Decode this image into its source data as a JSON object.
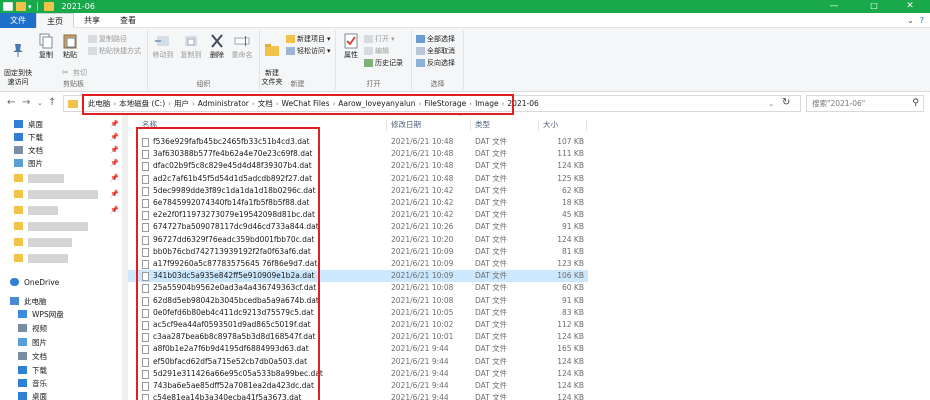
{
  "window": {
    "title": "2021-06",
    "minimize_glyph": "—",
    "maximize_glyph": "□",
    "close_glyph": "✕"
  },
  "ribbon_tabs": [
    "文件",
    "主页",
    "共享",
    "查看"
  ],
  "ribbon": {
    "clipboard": {
      "label": "剪贴板",
      "pin": "固定到快\n速访问",
      "copy": "复制",
      "paste": "粘贴",
      "copy_path": "复制路径",
      "paste_shortcut": "粘贴快捷方式",
      "cut": "剪切"
    },
    "organize": {
      "label": "组织",
      "move_to": "移动到",
      "copy_to": "复制到",
      "delete": "删除",
      "rename": "重命名"
    },
    "new": {
      "label": "新建",
      "new_folder": "新建\n文件夹",
      "new_item": "新建项目",
      "easy_access": "轻松访问"
    },
    "open": {
      "label": "打开",
      "properties": "属性",
      "open": "打开",
      "edit": "编辑",
      "history": "历史记录"
    },
    "select": {
      "label": "选择",
      "select_all": "全部选择",
      "select_none": "全部取消",
      "invert": "反向选择"
    }
  },
  "address": {
    "crumbs": [
      "此电脑",
      "本地磁盘 (C:)",
      "用户",
      "Administrator",
      "文档",
      "WeChat Files",
      "Aarow_loveyanyalun",
      "FileStorage",
      "Image",
      "2021-06"
    ],
    "separator": "›",
    "search_placeholder": "搜索\"2021-06\""
  },
  "nav_pane": {
    "quick_access": [
      {
        "label": "桌面",
        "icon": "desktop-icon",
        "color": "#2f7fd6"
      },
      {
        "label": "下载",
        "icon": "download-icon",
        "color": "#2f7fd6"
      },
      {
        "label": "文档",
        "icon": "documents-icon",
        "color": "#7a8ca3"
      },
      {
        "label": "图片",
        "icon": "pictures-icon",
        "color": "#5aa0d8"
      }
    ],
    "onedrive": "OneDrive",
    "this_pc": {
      "label": "此电脑",
      "items": [
        {
          "label": "WPS网盘",
          "icon": "cloud-icon",
          "color": "#3b8be0"
        },
        {
          "label": "视频",
          "icon": "videos-icon",
          "color": "#7a8ca3"
        },
        {
          "label": "图片",
          "icon": "pictures-icon",
          "color": "#5aa0d8"
        },
        {
          "label": "文档",
          "icon": "documents-icon",
          "color": "#7a8ca3"
        },
        {
          "label": "下载",
          "icon": "download-icon",
          "color": "#2f7fd6"
        },
        {
          "label": "音乐",
          "icon": "music-icon",
          "color": "#2f7fd6"
        },
        {
          "label": "桌面",
          "icon": "desktop-icon",
          "color": "#2f7fd6"
        }
      ]
    }
  },
  "columns": {
    "name": "名称",
    "date": "修改日期",
    "type": "类型",
    "size": "大小"
  },
  "files": [
    {
      "name": "f536e929fafb45bc2465fb33c51b4cd3.dat",
      "date": "2021/6/21 10:48",
      "type": "DAT 文件",
      "size": "107 KB"
    },
    {
      "name": "3af630388b577fe4b62a4e70e23c69f8.dat",
      "date": "2021/6/21 10:48",
      "type": "DAT 文件",
      "size": "111 KB"
    },
    {
      "name": "dfac02b9f5c8c829e45d4d48f39307b4.dat",
      "date": "2021/6/21 10:48",
      "type": "DAT 文件",
      "size": "124 KB"
    },
    {
      "name": "ad2c7af61b45f5d54d1d5adcdb892f27.dat",
      "date": "2021/6/21 10:48",
      "type": "DAT 文件",
      "size": "125 KB"
    },
    {
      "name": "5dec9989dde3f89c1da1da1d18b0296c.dat",
      "date": "2021/6/21 10:42",
      "type": "DAT 文件",
      "size": "62 KB"
    },
    {
      "name": "6e7845992074340fb14fa1fb5f8b5f88.dat",
      "date": "2021/6/21 10:42",
      "type": "DAT 文件",
      "size": "18 KB"
    },
    {
      "name": "e2e2f0f11973273079e19542098d81bc.dat",
      "date": "2021/6/21 10:42",
      "type": "DAT 文件",
      "size": "45 KB"
    },
    {
      "name": "674727ba509078117dc9d46cd733a844.dat",
      "date": "2021/6/21 10:26",
      "type": "DAT 文件",
      "size": "91 KB"
    },
    {
      "name": "96727dd6329f76eadc359bd001fbb70c.dat",
      "date": "2021/6/21 10:20",
      "type": "DAT 文件",
      "size": "124 KB"
    },
    {
      "name": "bb0b76cbd742713939192f2fa0f63af6.dat",
      "date": "2021/6/21 10:09",
      "type": "DAT 文件",
      "size": "81 KB"
    },
    {
      "name": "a17f99260a5c87783575645 76f86e9d7.dat",
      "date": "2021/6/21 10:09",
      "type": "DAT 文件",
      "size": "123 KB"
    },
    {
      "name": "341b03dc5a935e842ff5e910909e1b2a.dat",
      "date": "2021/6/21 10:09",
      "type": "DAT 文件",
      "size": "106 KB",
      "selected": true
    },
    {
      "name": "25a55904b9562e0ad3a4a436749363cf.dat",
      "date": "2021/6/21 10:08",
      "type": "DAT 文件",
      "size": "60 KB"
    },
    {
      "name": "62d8d5eb98042b3045bcedba5a9a674b.dat",
      "date": "2021/6/21 10:08",
      "type": "DAT 文件",
      "size": "91 KB"
    },
    {
      "name": "0e0fefd6b80eb4c411dc9213d75579c5.dat",
      "date": "2021/6/21 10:05",
      "type": "DAT 文件",
      "size": "83 KB"
    },
    {
      "name": "ac5cf9ea44af0593501d9ad865c5019f.dat",
      "date": "2021/6/21 10:02",
      "type": "DAT 文件",
      "size": "112 KB"
    },
    {
      "name": "c3aa287bea6b8c8978a5b3d8d168547f.dat",
      "date": "2021/6/21 10:01",
      "type": "DAT 文件",
      "size": "124 KB"
    },
    {
      "name": "a8f0b1e2a7f6b9d4195df6884993d63.dat",
      "date": "2021/6/21 9:44",
      "type": "DAT 文件",
      "size": "165 KB"
    },
    {
      "name": "ef50bfacd62df5a715e52cb7db0a503.dat",
      "date": "2021/6/21 9:44",
      "type": "DAT 文件",
      "size": "124 KB"
    },
    {
      "name": "5d291e311426a66e95c05a533b8a99bec.dat",
      "date": "2021/6/21 9:44",
      "type": "DAT 文件",
      "size": "124 KB"
    },
    {
      "name": "743ba6e5ae85dff52a7081ea2da423dc.dat",
      "date": "2021/6/21 9:44",
      "type": "DAT 文件",
      "size": "124 KB"
    },
    {
      "name": "c54e81ea14b3a340ecba41f5a3673.dat",
      "date": "2021/6/21 9:44",
      "type": "DAT 文件",
      "size": "124 KB"
    }
  ]
}
